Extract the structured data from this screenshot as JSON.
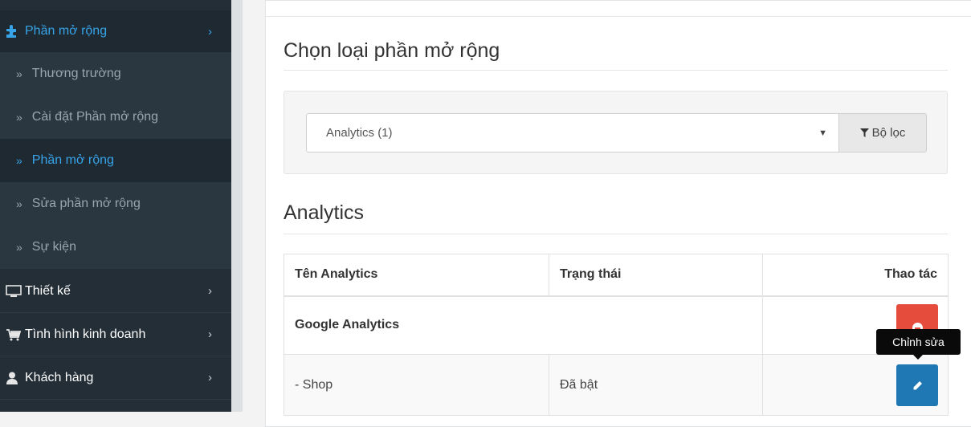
{
  "sidebar": {
    "extensions": {
      "label": "Phần mở rộng",
      "icon": "puzzle-icon"
    },
    "sub_items": [
      {
        "label": "Thương trường"
      },
      {
        "label": "Cài đặt Phần mở rộng"
      },
      {
        "label": "Phần mở rộng"
      },
      {
        "label": "Sửa phần mở rộng"
      },
      {
        "label": "Sự kiện"
      }
    ],
    "design": {
      "label": "Thiết kế",
      "icon": "monitor-icon"
    },
    "sales": {
      "label": "Tình hình kinh doanh",
      "icon": "cart-icon"
    },
    "customers": {
      "label": "Khách hàng",
      "icon": "user-icon"
    },
    "chevron": "›",
    "bullet": "»",
    "accent_color": "#37a4ea"
  },
  "main": {
    "choose_title": "Chọn loại phần mở rộng",
    "select_value": "Analytics (1)",
    "filter_label": "Bộ lọc",
    "section_title": "Analytics",
    "table": {
      "headers": [
        "Tên Analytics",
        "Trạng thái",
        "Thao tác"
      ],
      "group_name": "Google Analytics",
      "row": {
        "name": "- Shop",
        "status": "Đã bật"
      }
    },
    "tooltip": "Chỉnh sửa"
  }
}
